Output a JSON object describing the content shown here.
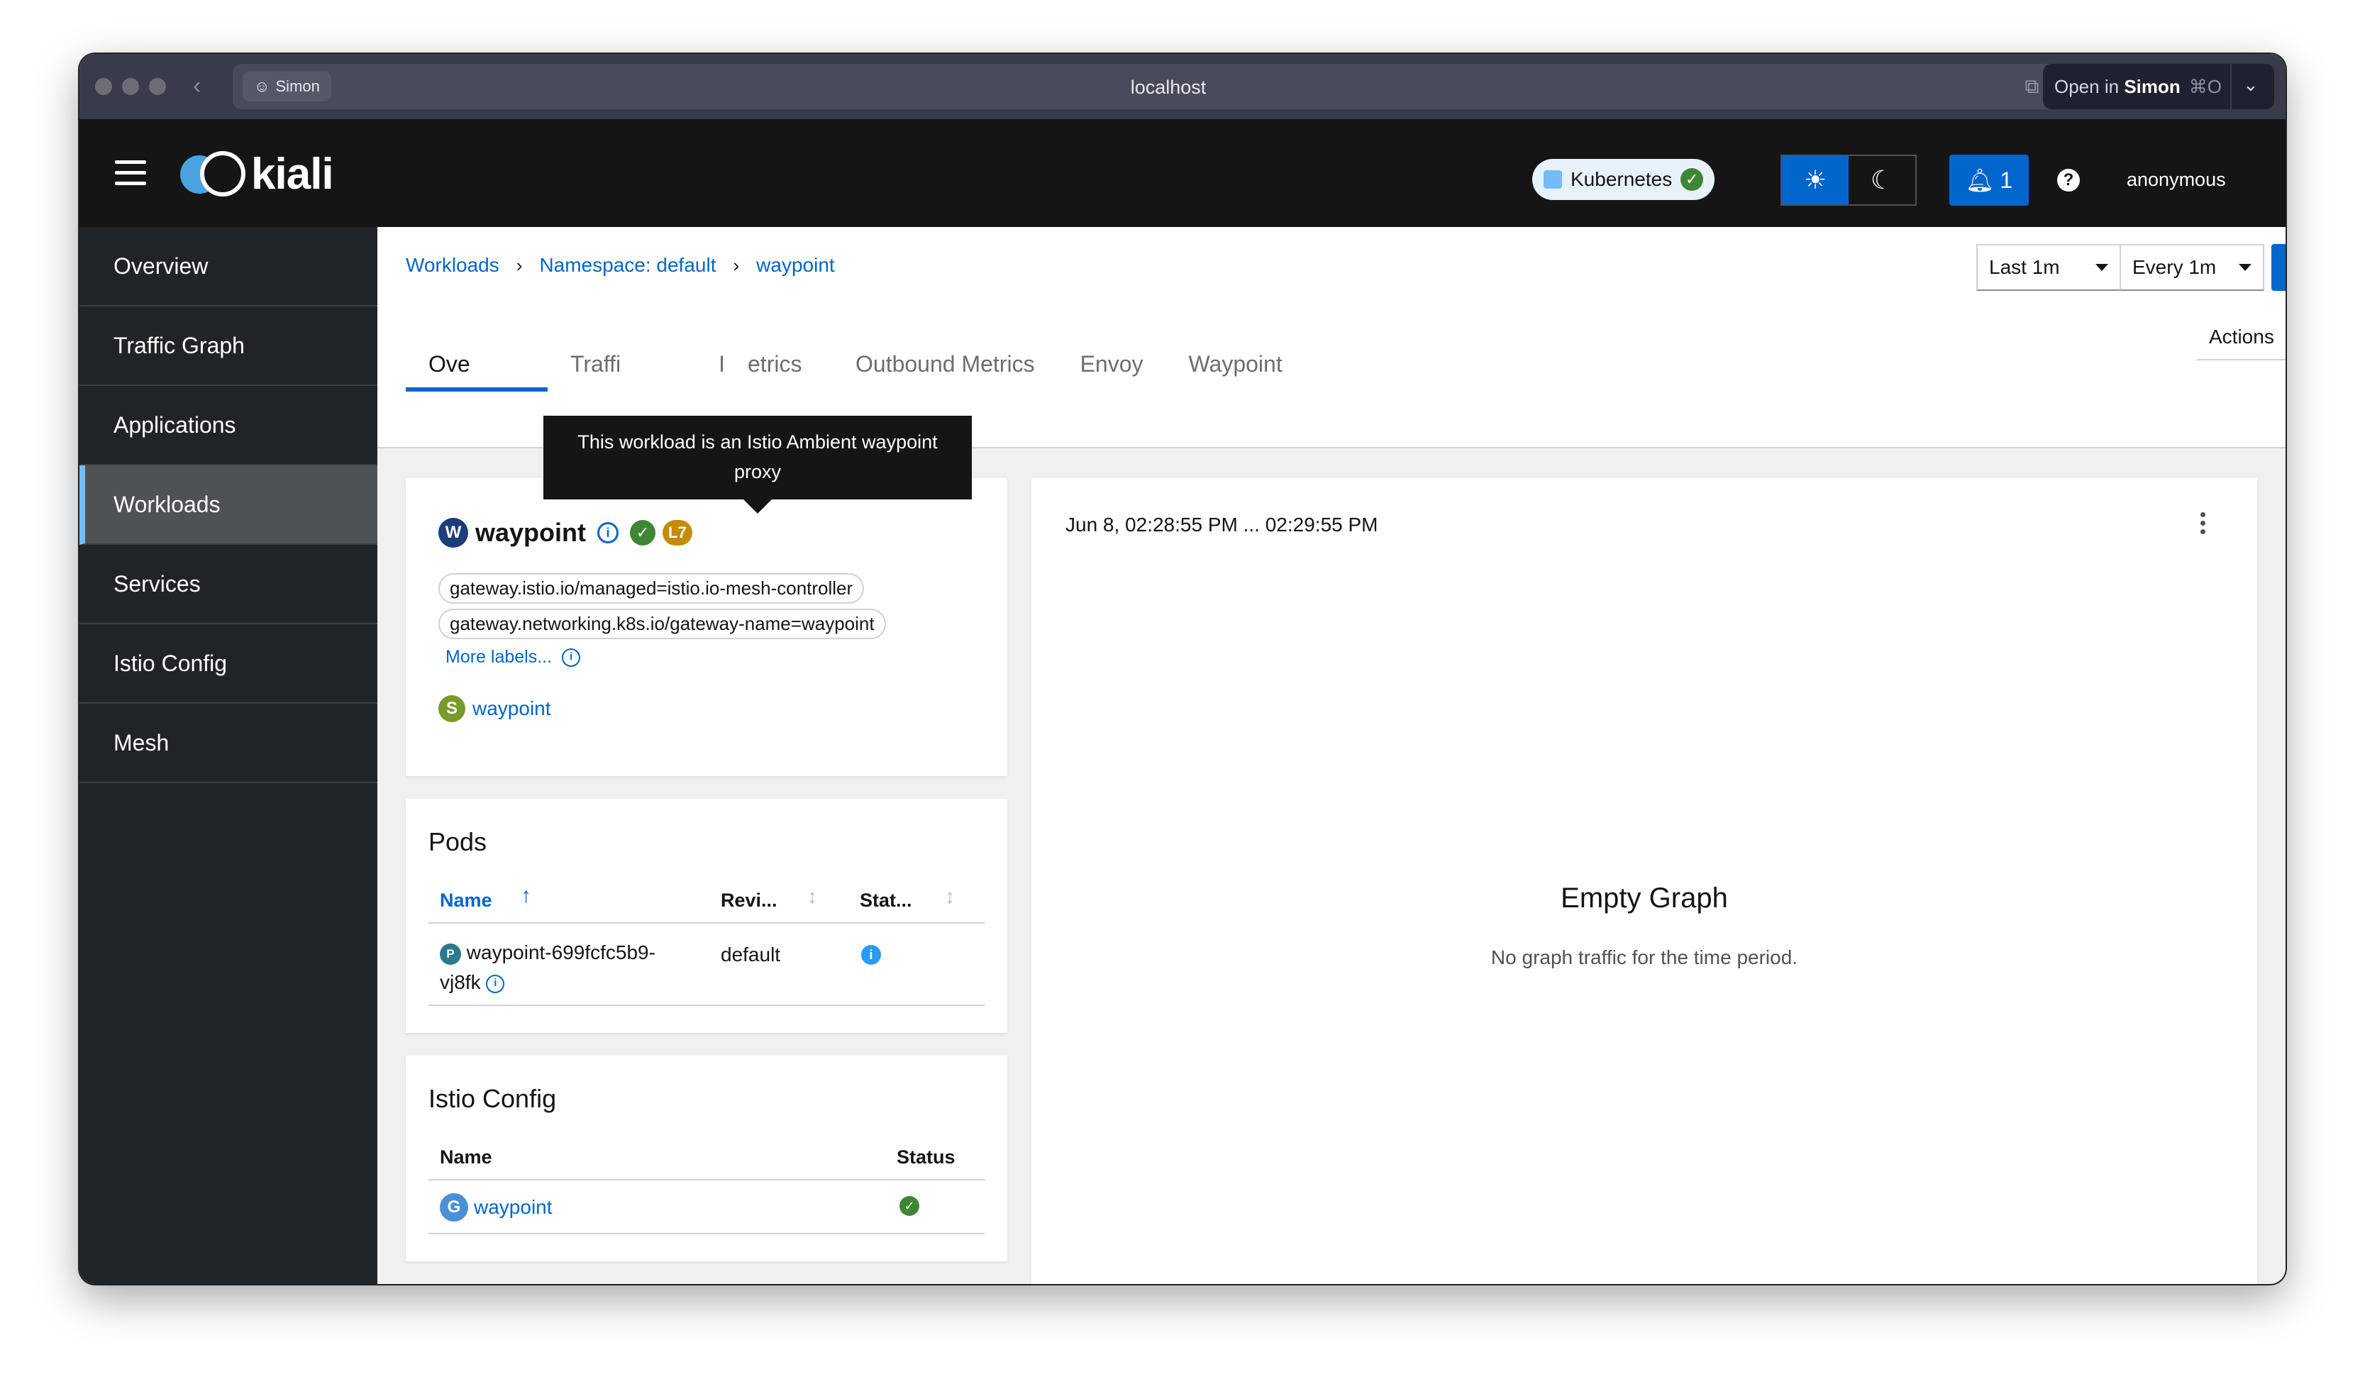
{
  "browser": {
    "profile": "Simon",
    "url": "localhost",
    "open_in_label": "Open in",
    "open_in_name": "Simon",
    "open_in_shortcut": "⌘O"
  },
  "masthead": {
    "logo_text": "kiali",
    "cluster_label": "Kubernetes",
    "notifications_count": "1",
    "user": "anonymous"
  },
  "sidebar": {
    "items": [
      {
        "label": "Overview"
      },
      {
        "label": "Traffic Graph"
      },
      {
        "label": "Applications"
      },
      {
        "label": "Workloads"
      },
      {
        "label": "Services"
      },
      {
        "label": "Istio Config"
      },
      {
        "label": "Mesh"
      }
    ],
    "active": "Workloads"
  },
  "breadcrumb": [
    "Workloads",
    "Namespace: default",
    "waypoint"
  ],
  "toolbar": {
    "duration": "Last 1m",
    "refresh_interval": "Every 1m",
    "actions_label": "Actions"
  },
  "tabs": [
    "Overview",
    "Traffic",
    "Inbound Metrics",
    "Outbound Metrics",
    "Envoy",
    "Waypoint"
  ],
  "tabs_visible": [
    "Ove",
    "Traffi",
    "I",
    "etrics",
    "Outbound Metrics",
    "Envoy",
    "Waypoint"
  ],
  "tooltip": {
    "line1": "This workload is an Istio Ambient waypoint",
    "line2": "proxy"
  },
  "workload": {
    "badge": "W",
    "name": "waypoint",
    "l7_badge": "L7",
    "labels": [
      "gateway.istio.io/managed=istio.io-mesh-controller",
      "gateway.networking.k8s.io/gateway-name=waypoint"
    ],
    "more_labels": "More labels...",
    "service_badge": "S",
    "service_name": "waypoint"
  },
  "pods": {
    "title": "Pods",
    "columns": [
      "Name",
      "Revi...",
      "Stat..."
    ],
    "rows": [
      {
        "badge": "P",
        "name_line1": "waypoint-699fcfc5b9-",
        "name_line2": "vj8fk",
        "revision": "default"
      }
    ]
  },
  "istio_config": {
    "title": "Istio Config",
    "columns": [
      "Name",
      "Status"
    ],
    "rows": [
      {
        "badge": "G",
        "name": "waypoint"
      }
    ]
  },
  "graph": {
    "time_range": "Jun 8, 02:28:55 PM ... 02:29:55 PM",
    "empty_title": "Empty Graph",
    "empty_text": "No graph traffic for the time period."
  },
  "colors": {
    "accent": "#0066cc",
    "masthead": "#151515",
    "sidebar": "#212427",
    "success": "#3e8635",
    "l7": "#c58c00"
  }
}
